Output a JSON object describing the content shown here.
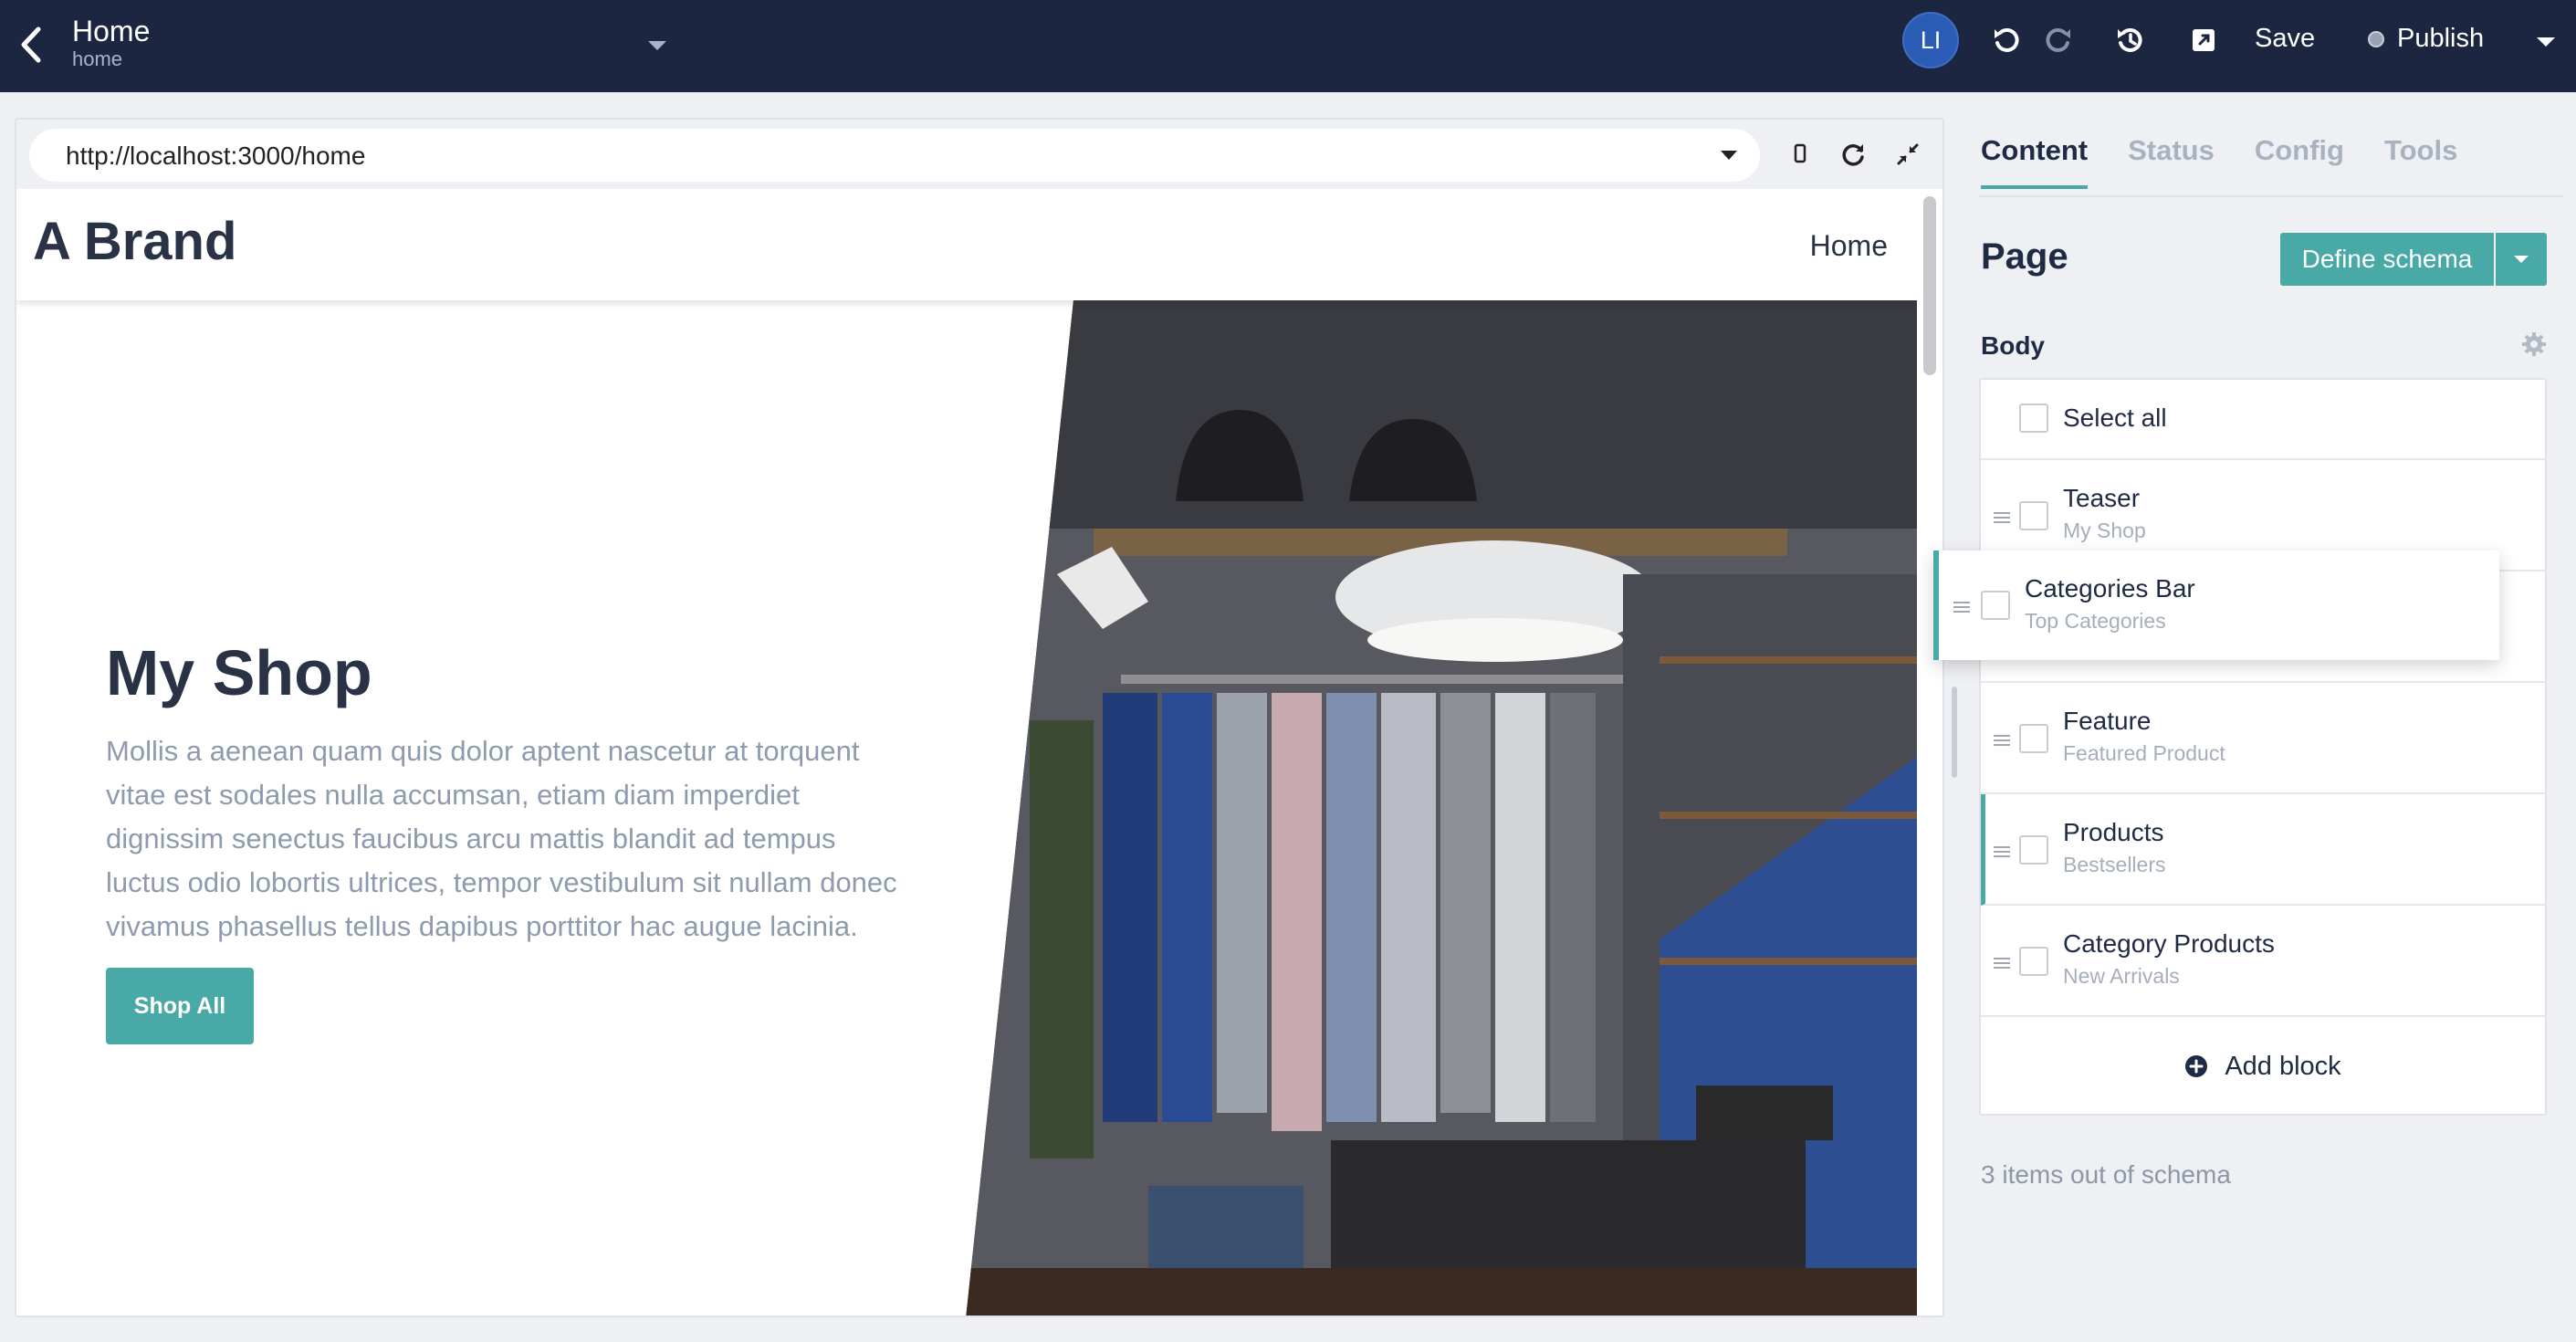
{
  "topbar": {
    "title": "Home",
    "subtitle": "home",
    "avatar_initials": "LI",
    "save_label": "Save",
    "publish_label": "Publish",
    "background": "#1c2640",
    "icons": [
      "back-icon",
      "chevron-down-icon",
      "undo-icon",
      "redo-icon",
      "history-icon",
      "external-link-icon",
      "chevron-down-icon"
    ]
  },
  "preview": {
    "url": "http://localhost:3000/home",
    "icons": [
      "mobile-icon",
      "refresh-icon",
      "collapse-icon"
    ],
    "site": {
      "brand": "A Brand",
      "nav_item": "Home",
      "hero_title": "My Shop",
      "hero_text": "Mollis a aenean quam quis dolor aptent nascetur at torquent vitae est sodales nulla accumsan, etiam diam imperdiet dignissim senectus faucibus arcu mattis blandit ad tempus luctus odio lobortis ultrices, tempor vestibulum sit nullam donec vivamus phasellus tellus dapibus porttitor hac augue lacinia.",
      "cta_label": "Shop All"
    }
  },
  "panel": {
    "tabs": [
      {
        "label": "Content",
        "active": true
      },
      {
        "label": "Status",
        "active": false
      },
      {
        "label": "Config",
        "active": false
      },
      {
        "label": "Tools",
        "active": false
      }
    ],
    "title": "Page",
    "define_schema_label": "Define schema",
    "body_label": "Body",
    "select_all_label": "Select all",
    "blocks": [
      {
        "label": "Teaser",
        "sub": "My Shop"
      },
      {
        "label": "Feature",
        "sub": "Featured Product"
      },
      {
        "label": "Products",
        "sub": "Bestsellers"
      },
      {
        "label": "Category Products",
        "sub": "New Arrivals"
      }
    ],
    "dragging_block": {
      "label": "Categories Bar",
      "sub": "Top Categories"
    },
    "add_block_label": "Add block",
    "footer_note": "3 items out of schema",
    "accent": "#48a9a6"
  }
}
